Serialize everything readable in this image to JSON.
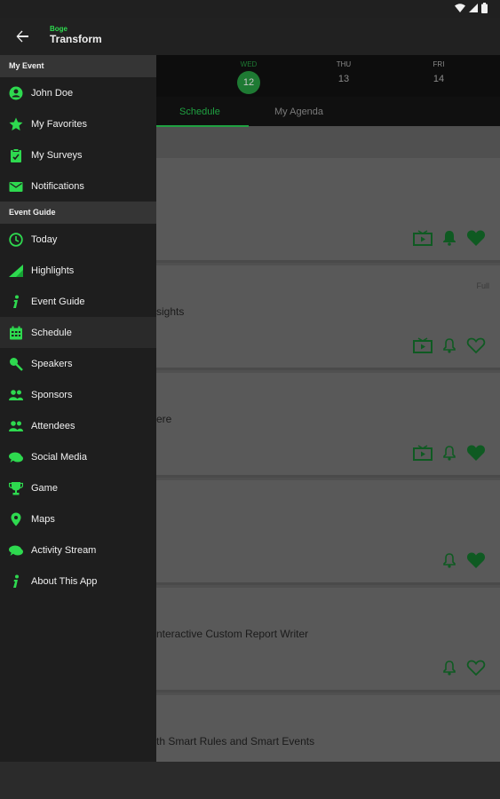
{
  "app": {
    "logo_small": "Boge",
    "logo_big": "Transform"
  },
  "colors": {
    "accent": "#2ed94f",
    "drawer_bg": "#1e1e1e",
    "section_bg": "#353535"
  },
  "dates": [
    {
      "dow": "",
      "num": ""
    },
    {
      "dow": "WED",
      "num": "12"
    },
    {
      "dow": "THU",
      "num": "13"
    },
    {
      "dow": "FRI",
      "num": "14"
    }
  ],
  "tabs": [
    "Schedule",
    "My Agenda"
  ],
  "rows": [
    {
      "title": "",
      "tag": "",
      "favorite": true,
      "has_video": true,
      "bell_filled": true
    },
    {
      "title": "sights",
      "tag": "Full",
      "favorite": false,
      "has_video": true,
      "bell_filled": false
    },
    {
      "title": "ere",
      "tag": "",
      "favorite": true,
      "has_video": true,
      "bell_filled": false
    },
    {
      "title": "",
      "tag": "",
      "favorite": true,
      "has_video": false,
      "bell_filled": false
    },
    {
      "title": "nteractive Custom Report Writer",
      "tag": "",
      "favorite": false,
      "has_video": false,
      "bell_filled": false
    },
    {
      "title": "th Smart Rules and Smart Events",
      "tag": "",
      "favorite": false,
      "has_video": false,
      "bell_filled": false
    }
  ],
  "drawer": {
    "my_event_header": "My Event",
    "my_event_items": [
      {
        "label": "John Doe",
        "icon": "person-icon"
      },
      {
        "label": "My Favorites",
        "icon": "star-icon"
      },
      {
        "label": "My Surveys",
        "icon": "survey-icon"
      },
      {
        "label": "Notifications",
        "icon": "mail-icon"
      }
    ],
    "event_guide_header": "Event Guide",
    "event_guide_items": [
      {
        "label": "Today",
        "icon": "clock-icon"
      },
      {
        "label": "Highlights",
        "icon": "signal-icon"
      },
      {
        "label": "Event Guide",
        "icon": "info-icon"
      },
      {
        "label": "Schedule",
        "icon": "calendar-icon",
        "active": true
      },
      {
        "label": "Speakers",
        "icon": "microphone-icon"
      },
      {
        "label": "Sponsors",
        "icon": "group-icon"
      },
      {
        "label": "Attendees",
        "icon": "group-icon"
      },
      {
        "label": "Social Media",
        "icon": "chat-icon"
      },
      {
        "label": "Game",
        "icon": "trophy-icon"
      },
      {
        "label": "Maps",
        "icon": "map-pin-icon"
      },
      {
        "label": "Activity Stream",
        "icon": "chat-icon"
      },
      {
        "label": "About This App",
        "icon": "info-icon"
      }
    ]
  }
}
